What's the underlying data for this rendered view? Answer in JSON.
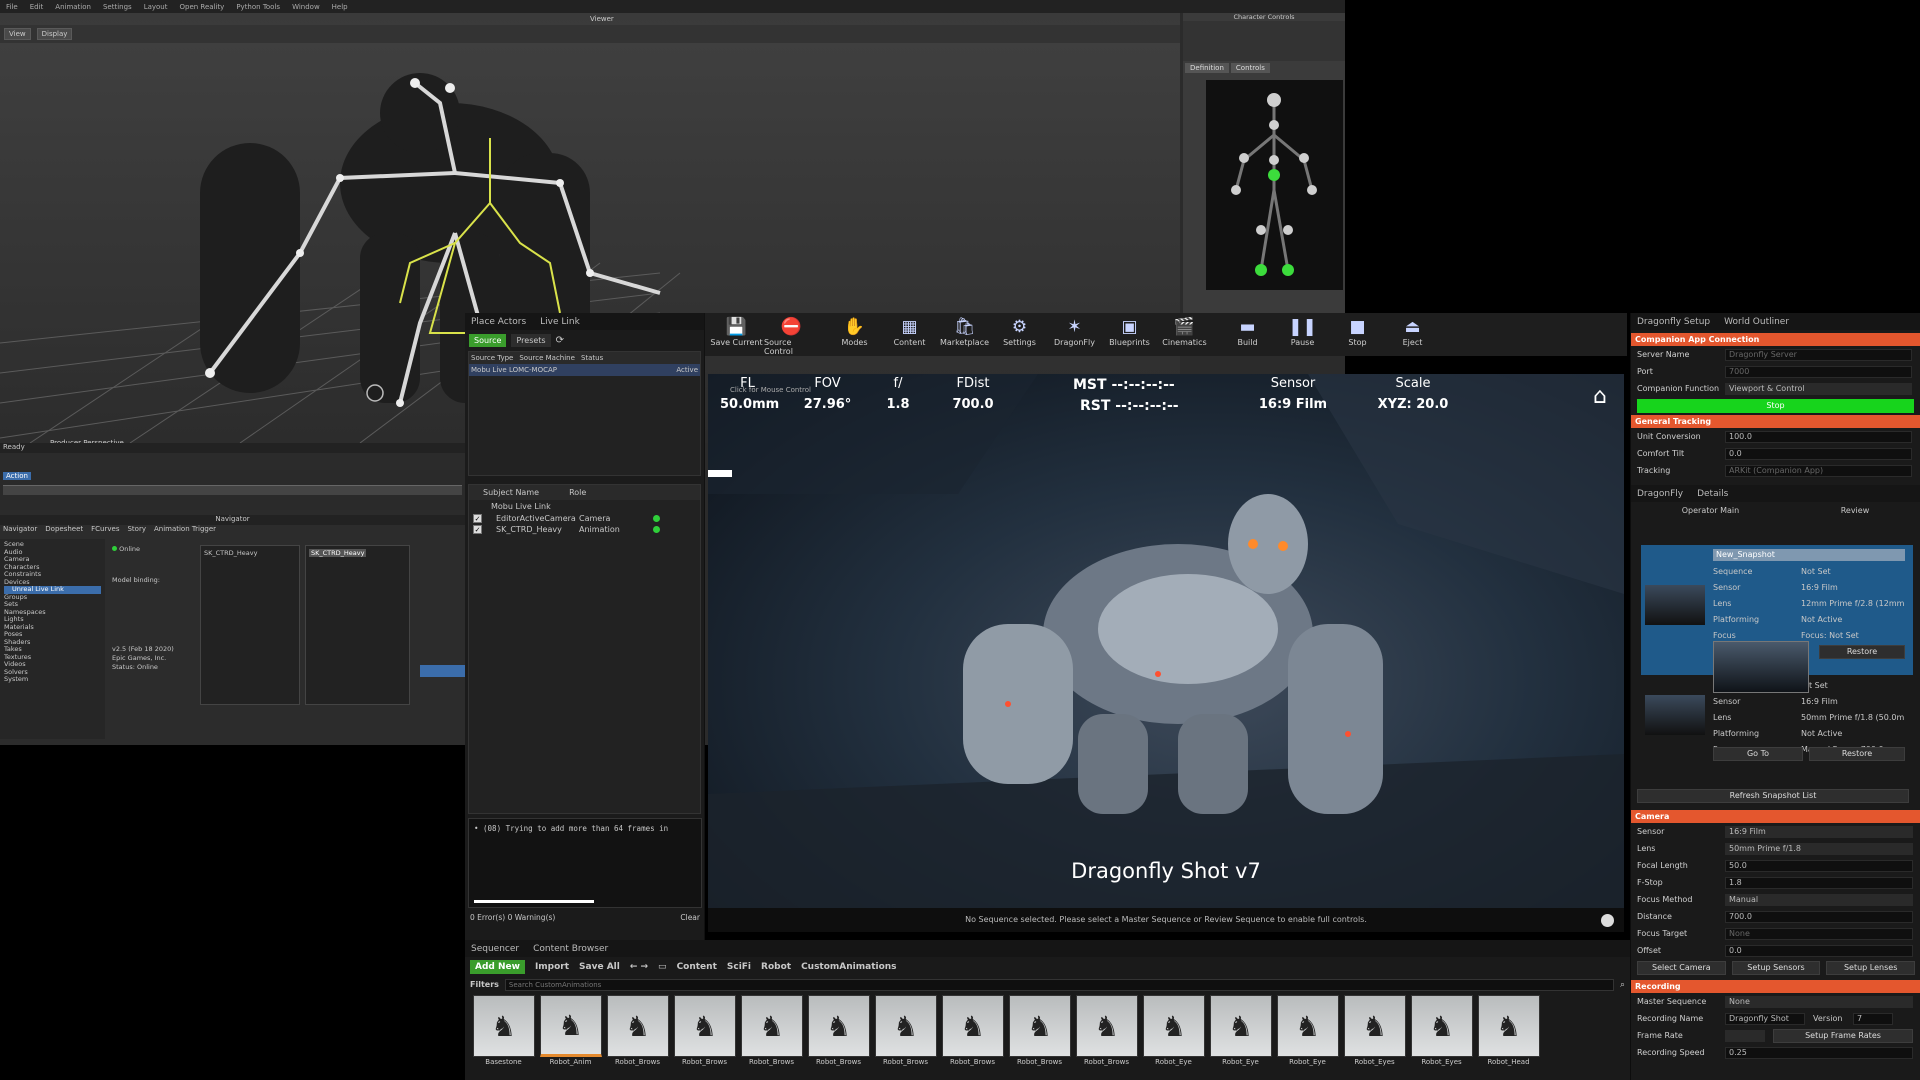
{
  "mobu": {
    "menu": [
      "File",
      "Edit",
      "Animation",
      "Settings",
      "Layout",
      "Open Reality",
      "Python Tools",
      "Window",
      "Help"
    ],
    "viewer_title": "Viewer",
    "toolbar_left": [
      "View",
      "Display"
    ],
    "char_ctrl_title": "Character Controls",
    "char_ctrl_tabs": [
      "Definition",
      "Controls"
    ],
    "status": "Ready",
    "transport": "Action",
    "navigator_title": "Navigator",
    "navigator_tabs": [
      "Navigator",
      "Dopesheet",
      "FCurves",
      "Story",
      "Animation Trigger"
    ],
    "tree_items": [
      "Scene",
      "Audio",
      "Camera",
      "Characters",
      "Constraints",
      "Devices",
      "Groups",
      "Sets",
      "Namespaces",
      "Lights",
      "Materials",
      "Poses",
      "Shaders",
      "Takes",
      "Textures",
      "Videos",
      "Solvers",
      "System"
    ],
    "device_selected": "Unreal Live Link",
    "device_label": "Online",
    "model_binding": "Model binding:",
    "subject_name": "SK_CTRD_Heavy",
    "version_info": "v2.5 (Feb 18 2020)",
    "company": "Epic Games, Inc.",
    "status_online": "Status: Online"
  },
  "ue": {
    "left_tabs": [
      "Place Actors",
      "Live Link"
    ],
    "source_btn": "Source",
    "presets_btn": "Presets",
    "source_header": [
      "Source Type",
      "Source Machine",
      "Status"
    ],
    "source_row": "Mobu Live LOMC-MOCAP",
    "source_status": "Active",
    "subject_header": [
      "Subject Name",
      "Role"
    ],
    "subject_group": "Mobu Live Link",
    "subjects": [
      {
        "name": "EditorActiveCamera",
        "role": "Camera"
      },
      {
        "name": "SK_CTRD_Heavy",
        "role": "Animation"
      }
    ],
    "log_line": "• (08) Trying to add more than 64 frames in",
    "log_status": "0 Error(s)  0 Warning(s)",
    "log_clear": "Clear",
    "toolbar": [
      {
        "label": "Save Current",
        "icon": "💾",
        "name": "save-icon"
      },
      {
        "label": "Source Control",
        "icon": "⛔",
        "name": "source-control-icon"
      },
      {
        "label": "Modes",
        "icon": "✋",
        "name": "modes-icon"
      },
      {
        "label": "Content",
        "icon": "▦",
        "name": "content-icon"
      },
      {
        "label": "Marketplace",
        "icon": "🛍",
        "name": "marketplace-icon"
      },
      {
        "label": "Settings",
        "icon": "⚙",
        "name": "settings-icon"
      },
      {
        "label": "DragonFly",
        "icon": "✶",
        "name": "dragonfly-icon"
      },
      {
        "label": "Blueprints",
        "icon": "▣",
        "name": "blueprints-icon"
      },
      {
        "label": "Cinematics",
        "icon": "🎬",
        "name": "cinematics-icon"
      },
      {
        "label": "Build",
        "icon": "▬",
        "name": "build-icon"
      },
      {
        "label": "Pause",
        "icon": "❚❚",
        "name": "pause-icon"
      },
      {
        "label": "Stop",
        "icon": "■",
        "name": "stop-icon"
      },
      {
        "label": "Eject",
        "icon": "⏏",
        "name": "eject-icon"
      }
    ],
    "hud": {
      "fl_label": "FL",
      "fl": "50.0mm",
      "fov_label": "FOV",
      "fov": "27.96°",
      "f_label": "f/",
      "f": "1.8",
      "fdist_label": "FDist",
      "fdist": "700.0",
      "mst": "MST --:--:--:--",
      "rst": "RST --:--:--:--",
      "sensor_label": "Sensor",
      "sensor": "16:9 Film",
      "scale_label": "Scale",
      "scale": "XYZ: 20.0",
      "hint": "Click for Mouse Control",
      "shot_title": "Dragonfly Shot v7",
      "notice": "No Sequence selected. Please select a Master Sequence or Review Sequence to enable full controls."
    },
    "bottom_tabs": [
      "Sequencer",
      "Content Browser"
    ],
    "add_new": "Add New",
    "import": "Import",
    "save_all": "Save All",
    "breadcrumb": [
      "Content",
      "SciFi",
      "Robot",
      "CustomAnimations"
    ],
    "filters": "Filters",
    "search_placeholder": "Search CustomAnimations",
    "assets": [
      "Basestone",
      "Robot_Anim",
      "Robot_Brows",
      "Robot_Brows",
      "Robot_Brows",
      "Robot_Brows",
      "Robot_Brows",
      "Robot_Brows",
      "Robot_Brows",
      "Robot_Brows",
      "Robot_Eye",
      "Robot_Eye",
      "Robot_Eye",
      "Robot_Eyes",
      "Robot_Eyes",
      "Robot_Head"
    ]
  },
  "right": {
    "tabs": [
      "Dragonfly Setup",
      "World Outliner"
    ],
    "companion_head": "Companion App Connection",
    "server_name_label": "Server Name",
    "server_name": "Dragonfly Server",
    "port_label": "Port",
    "port": "7000",
    "function_label": "Companion Function",
    "function": "Viewport & Control",
    "stop_btn": "Stop",
    "tracking_head": "General Tracking",
    "unit_label": "Unit Conversion",
    "unit": "100.0",
    "tilt_label": "Comfort Tilt",
    "tilt": "0.0",
    "tracking_label": "Tracking",
    "tracking": "ARKit (Companion App)",
    "tabs2": [
      "DragonFly",
      "Details"
    ],
    "op_tabs": [
      "Operator Main",
      "Review"
    ],
    "snap1": {
      "name": "New_Snapshot",
      "rows": [
        [
          "Sequence",
          "Not Set"
        ],
        [
          "Sensor",
          "16:9 Film"
        ],
        [
          "Lens",
          "12mm Prime f/2.8 (12mm"
        ],
        [
          "Platforming",
          "Not Active"
        ],
        [
          "Focus",
          "Focus: Not Set"
        ]
      ],
      "restore": "Restore"
    },
    "snap2": {
      "seq": "t Set",
      "rows": [
        [
          "Sensor",
          "16:9 Film"
        ],
        [
          "Lens",
          "50mm Prime f/1.8 (50.0m"
        ],
        [
          "Platforming",
          "Not Active"
        ],
        [
          "Focus",
          "Manual Focus: 700.0"
        ]
      ],
      "goto": "Go To",
      "restore": "Restore"
    },
    "refresh": "Refresh Snapshot List",
    "camera_head": "Camera",
    "cam_rows": [
      [
        "Sensor",
        "16:9 Film"
      ],
      [
        "Lens",
        "50mm Prime f/1.8"
      ],
      [
        "Focal Length",
        "50.0"
      ],
      [
        "F-Stop",
        "1.8"
      ],
      [
        "Focus Method",
        "Manual"
      ],
      [
        "Distance",
        "700.0"
      ],
      [
        "Focus Target",
        "None"
      ],
      [
        "Offset",
        "0.0"
      ]
    ],
    "cam_btns": [
      "Select Camera",
      "Setup Sensors",
      "Setup Lenses"
    ],
    "recording_head": "Recording",
    "master_seq_label": "Master Sequence",
    "master_seq": "None",
    "rec_name_label": "Recording Name",
    "rec_name": "Dragonfly Shot",
    "version_label": "Version",
    "version": "7",
    "frame_rate_label": "Frame Rate",
    "setup_fr": "Setup Frame Rates",
    "rec_speed_label": "Recording Speed",
    "rec_speed": "0.25"
  },
  "colors": {
    "accent": "#e4572e",
    "green": "#2fcf3a",
    "blue": "#1f5a8a"
  }
}
